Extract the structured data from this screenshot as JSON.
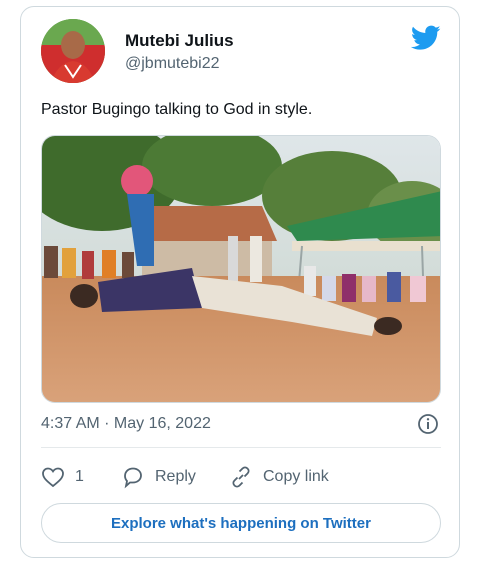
{
  "author": {
    "display_name": "Mutebi Julius",
    "handle": "@jbmutebi22",
    "avatar_icon": "profile-photo"
  },
  "brand": {
    "icon": "twitter-bird-icon",
    "color": "#1d9bf0"
  },
  "tweet": {
    "text": "Pastor Bugingo talking to God in style.",
    "timestamp": "4:37 AM · May 16, 2022"
  },
  "actions": {
    "like_count": "1",
    "reply_label": "Reply",
    "copy_link_label": "Copy link"
  },
  "explore_button": {
    "label": "Explore what's happening on Twitter"
  },
  "colors": {
    "text_primary": "#0f1419",
    "text_secondary": "#536471",
    "border": "#cfd9de",
    "link": "#1d6fbf"
  }
}
